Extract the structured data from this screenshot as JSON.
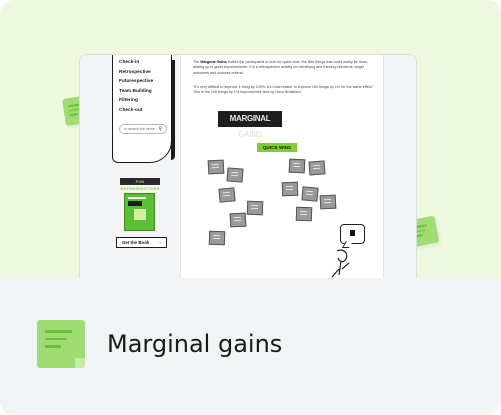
{
  "card": {
    "title": "Marginal gains",
    "colors": {
      "hero_bg": "#eef8df",
      "bottom_bg": "#f1f4f5",
      "accent_green": "#9fdc72"
    }
  },
  "sidebar": {
    "menu_items": [
      "Check-in",
      "Retrospective",
      "Futurespective",
      "Team Building",
      "Filtering",
      "Check-out"
    ],
    "search_placeholder": "or search the items",
    "book_label": "FUN RETROSPECTIVES",
    "book_cta": "Get the Book"
  },
  "content": {
    "intro_bold": "Marginal Gains",
    "intro_before": "The ",
    "intro_after": " invites the participants to look for quick wins, the little things that could easily be done, adding up to great improvements. It is a retrospective activity for identifying and framing intentions, target outcomes and success criteria.",
    "quote": "\"It's very difficult to improve 1 thing by 100%, it's much easier to improve 100 things by 1% for the same effect.\" This is the 100 things by 1% improvement idea by Dave Brailsford.",
    "board_title": "MARGINAL GAINS",
    "board_subtitle": "QUICK WINS"
  },
  "icons": [
    "search-icon",
    "arrow-right-icon",
    "sticky-note-icon",
    "speech-bubble-icon"
  ]
}
